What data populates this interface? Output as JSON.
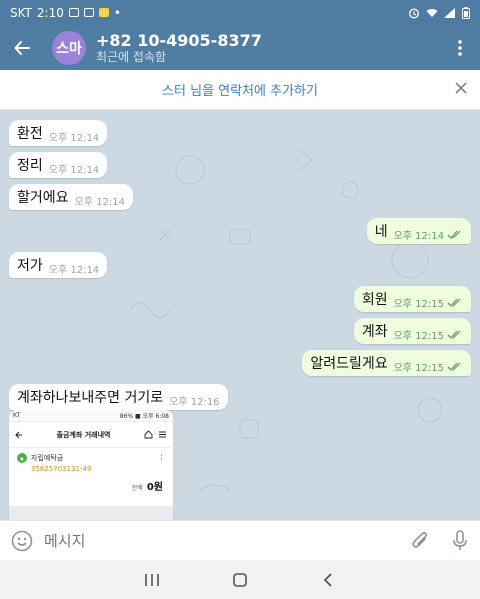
{
  "status_bar": {
    "carrier": "SKT",
    "time": "2:10",
    "dot": "•"
  },
  "header": {
    "avatar_text": "스마",
    "title": "+82 10-4905-8377",
    "subtitle": "최근에 접속함"
  },
  "banner": {
    "text": "스터 님을 연락처에 추가하기"
  },
  "messages": [
    {
      "text": "환전",
      "time": "오후 12:14"
    },
    {
      "text": "정리",
      "time": "오후 12:14"
    },
    {
      "text": "할거에요",
      "time": "오후 12:14"
    },
    {
      "text": "네",
      "time": "오후 12:14"
    },
    {
      "text": "저가",
      "time": "오후 12:14"
    },
    {
      "text": "회원",
      "time": "오후 12:15"
    },
    {
      "text": "계좌",
      "time": "오후 12:15"
    },
    {
      "text": "알려드릴게요",
      "time": "오후 12:15"
    },
    {
      "text": "계좌하나보내주면 거기로",
      "time": "오후 12:16"
    }
  ],
  "shared_image": {
    "status_left": "KT",
    "status_right": "86% ■ 오후 6:08",
    "title": "출금계좌 거래내역",
    "account_name": "자립예탁금",
    "account_number": "35625703131-49",
    "balance_label": "잔액",
    "balance_value": "0원"
  },
  "input": {
    "placeholder": "메시지"
  },
  "colors": {
    "header": "#517da2",
    "outgoing_bubble": "#effdde",
    "incoming_bubble": "#ffffff",
    "chat_bg": "#ccd8e2"
  }
}
